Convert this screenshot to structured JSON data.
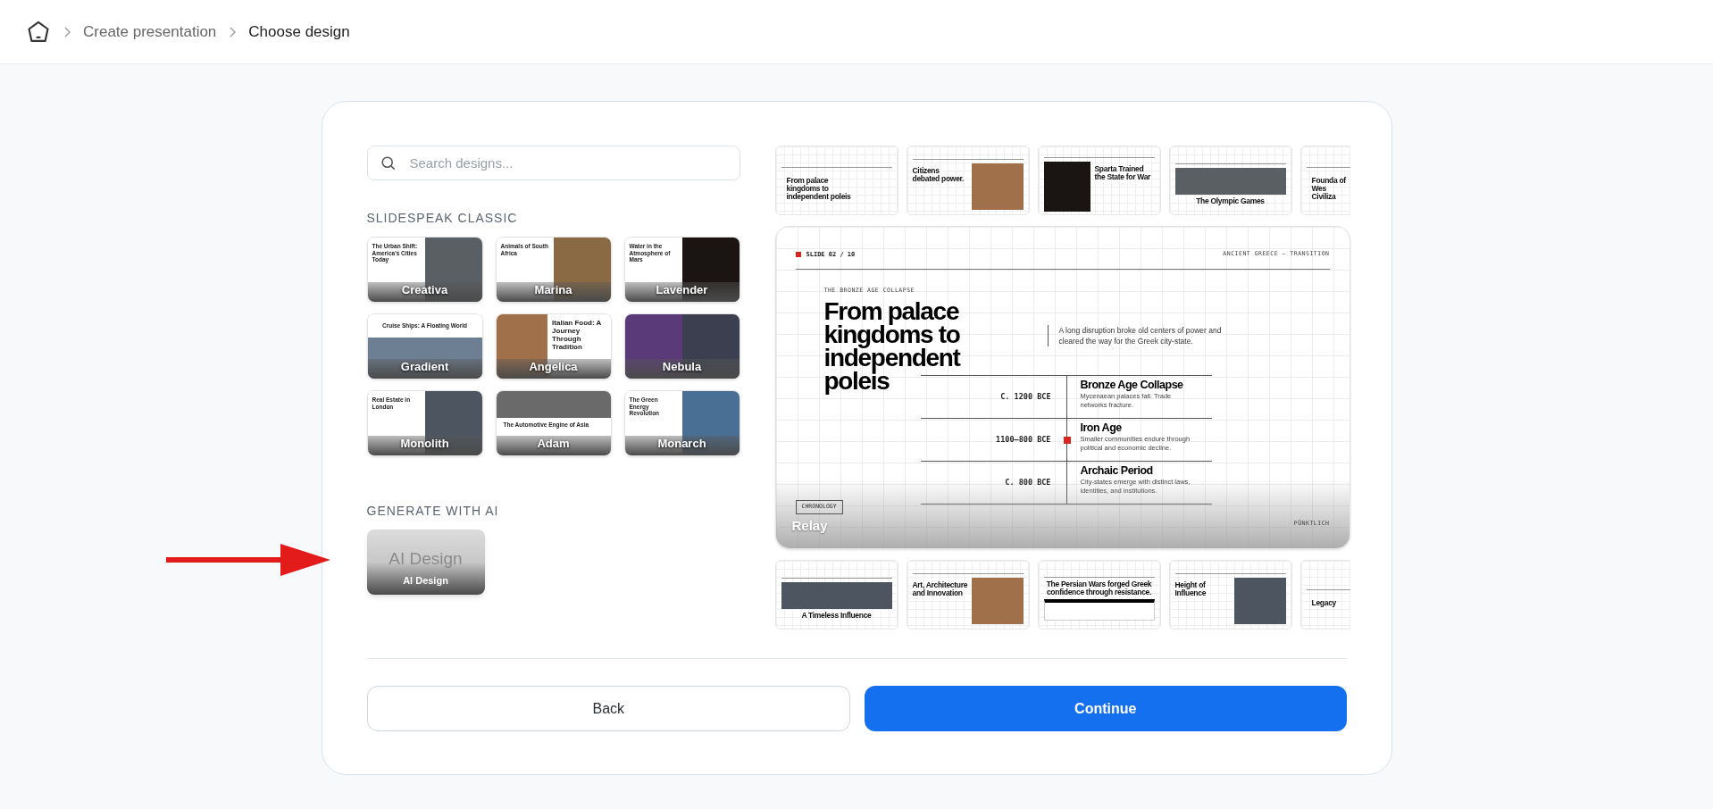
{
  "breadcrumb": [
    {
      "label": "Create presentation",
      "current": false
    },
    {
      "label": "Choose design",
      "current": true
    }
  ],
  "search": {
    "placeholder": "Search designs..."
  },
  "classic": {
    "heading": "SLIDESPEAK CLASSIC",
    "designs": [
      {
        "label": "Creativa",
        "slide_title": "The Urban Shift: America's Cities Today",
        "kind": "split"
      },
      {
        "label": "Marina",
        "slide_title": "Animals of South Africa",
        "kind": "split"
      },
      {
        "label": "Lavender",
        "slide_title": "Water in the Atmosphere of Mars",
        "kind": "split"
      },
      {
        "label": "Gradient",
        "slide_title": "Cruise Ships: A Floating World",
        "kind": "banner"
      },
      {
        "label": "Angelica",
        "slide_title": "Italian Food: A Journey Through Tradition",
        "kind": "photo-left"
      },
      {
        "label": "Nebula",
        "kind": "split"
      },
      {
        "label": "Monolith",
        "slide_title": "Real Estate in London",
        "kind": "split"
      },
      {
        "label": "Adam",
        "slide_title": "The Automotive Engine of Asia",
        "kind": "photo-top"
      },
      {
        "label": "Monarch",
        "slide_title": "The Green Energy Revolution",
        "kind": "split"
      }
    ]
  },
  "ai": {
    "heading": "GENERATE WITH AI",
    "preview_text": "AI Design",
    "label": "AI Design"
  },
  "top_thumbnails": [
    {
      "title": "From palace kingdoms to independent poleis",
      "kind": "text"
    },
    {
      "title": "Citizens debated power.",
      "kind": "photo-right"
    },
    {
      "title": "Sparta Trained the State for War",
      "kind": "photo-left"
    },
    {
      "title": "The Olympic Games",
      "kind": "banner"
    },
    {
      "title": "Founda of Wes Civiliza",
      "kind": "text"
    }
  ],
  "preview": {
    "slide_number": "SLIDE 02 / 10",
    "topic": "ANCIENT GREECE — TRANSITION",
    "eyebrow": "THE BRONZE AGE COLLAPSE",
    "title": "From palace kingdoms to independent poleis",
    "summary": "A long disruption broke old centers of power and cleared the way for the Greek city-state.",
    "timeline": [
      {
        "date": "C. 1200 BCE",
        "heading": "Bronze Age Collapse",
        "text": "Mycenaean palaces fall. Trade networks fracture.",
        "highlighted": false
      },
      {
        "date": "1100–800 BCE",
        "heading": "Iron Age",
        "text": "Smaller communities endure through political and economic decline.",
        "highlighted": true
      },
      {
        "date": "C. 800 BCE",
        "heading": "Archaic Period",
        "text": "City-states emerge with distinct laws, identities, and institutions.",
        "highlighted": false
      }
    ],
    "tag": "CHRONOLOGY",
    "brand": "PÜNKTLICH",
    "design_name": "Relay"
  },
  "bottom_thumbnails": [
    {
      "title": "A Timeless Influence",
      "kind": "banner"
    },
    {
      "title": "Art, Architecture and Innovation",
      "kind": "photo-right"
    },
    {
      "title": "The Persian Wars forged Greek confidence through resistance.",
      "kind": "table"
    },
    {
      "title": "Height of Influence",
      "kind": "photo-right"
    },
    {
      "title": "Legacy",
      "kind": "text"
    }
  ],
  "buttons": {
    "back": "Back",
    "continue": "Continue"
  }
}
